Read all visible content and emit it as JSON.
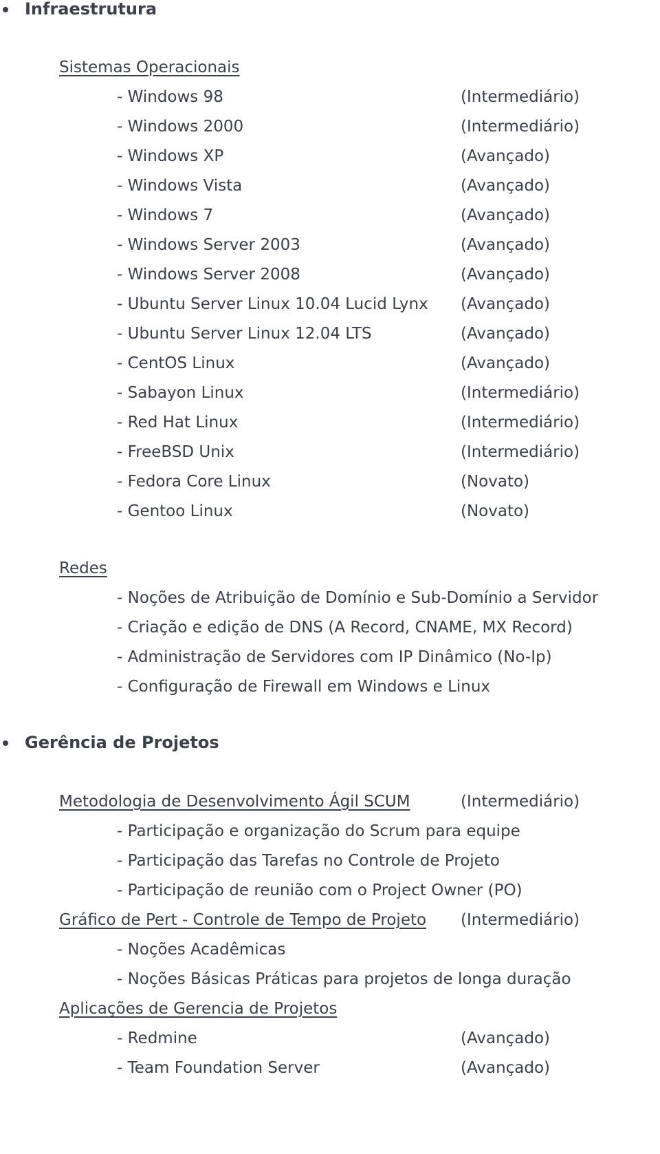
{
  "sections": [
    {
      "title": "Infraestrutura",
      "groups": [
        {
          "title": "Sistemas Operacionais",
          "items": [
            {
              "name": "- Windows 98",
              "level": "(Intermediário)"
            },
            {
              "name": "- Windows 2000",
              "level": "(Intermediário)"
            },
            {
              "name": "- Windows XP",
              "level": "(Avançado)"
            },
            {
              "name": "- Windows Vista",
              "level": "(Avançado)"
            },
            {
              "name": "- Windows 7",
              "level": "(Avançado)"
            },
            {
              "name": "- Windows Server 2003",
              "level": "(Avançado)"
            },
            {
              "name": "- Windows Server 2008",
              "level": "(Avançado)"
            },
            {
              "name": "- Ubuntu Server Linux 10.04 Lucid Lynx",
              "level": "(Avançado)"
            },
            {
              "name": "- Ubuntu Server Linux 12.04 LTS",
              "level": "(Avançado)"
            },
            {
              "name": "- CentOS Linux",
              "level": "(Avançado)"
            },
            {
              "name": "- Sabayon Linux",
              "level": "(Intermediário)"
            },
            {
              "name": "- Red Hat Linux",
              "level": "(Intermediário)"
            },
            {
              "name": "- FreeBSD Unix",
              "level": "(Intermediário)"
            },
            {
              "name": "- Fedora Core Linux",
              "level": "(Novato)"
            },
            {
              "name": "- Gentoo Linux",
              "level": "(Novato)"
            }
          ]
        },
        {
          "title": "Redes",
          "items": [
            {
              "name": "- Noções de Atribuição de Domínio e Sub-Domínio a Servidor"
            },
            {
              "name": "- Criação e edição de DNS (A Record, CNAME, MX Record)"
            },
            {
              "name": "- Administração de Servidores com IP Dinâmico (No-Ip)"
            },
            {
              "name": "- Configuração de Firewall em Windows e Linux"
            }
          ]
        }
      ]
    },
    {
      "title": "Gerência de Projetos",
      "groups": [
        {
          "title": "Metodologia de Desenvolvimento Ágil SCUM",
          "level": "(Intermediário)",
          "items": [
            {
              "name": "- Participação e organização do Scrum para equipe"
            },
            {
              "name": "- Participação das Tarefas no Controle de Projeto"
            },
            {
              "name": "- Participação de reunião com o Project Owner (PO)"
            }
          ]
        },
        {
          "title": "Gráfico de Pert - Controle de Tempo de Projeto",
          "level": "(Intermediário)",
          "items": [
            {
              "name": "- Noções Acadêmicas"
            },
            {
              "name": "- Noções Básicas Práticas para projetos de longa duração"
            }
          ]
        },
        {
          "title": "Aplicações de Gerencia de Projetos",
          "items": [
            {
              "name": "- Redmine",
              "level": "(Avançado)"
            },
            {
              "name": "- Team Foundation Server",
              "level": "(Avançado)"
            }
          ]
        }
      ]
    }
  ]
}
